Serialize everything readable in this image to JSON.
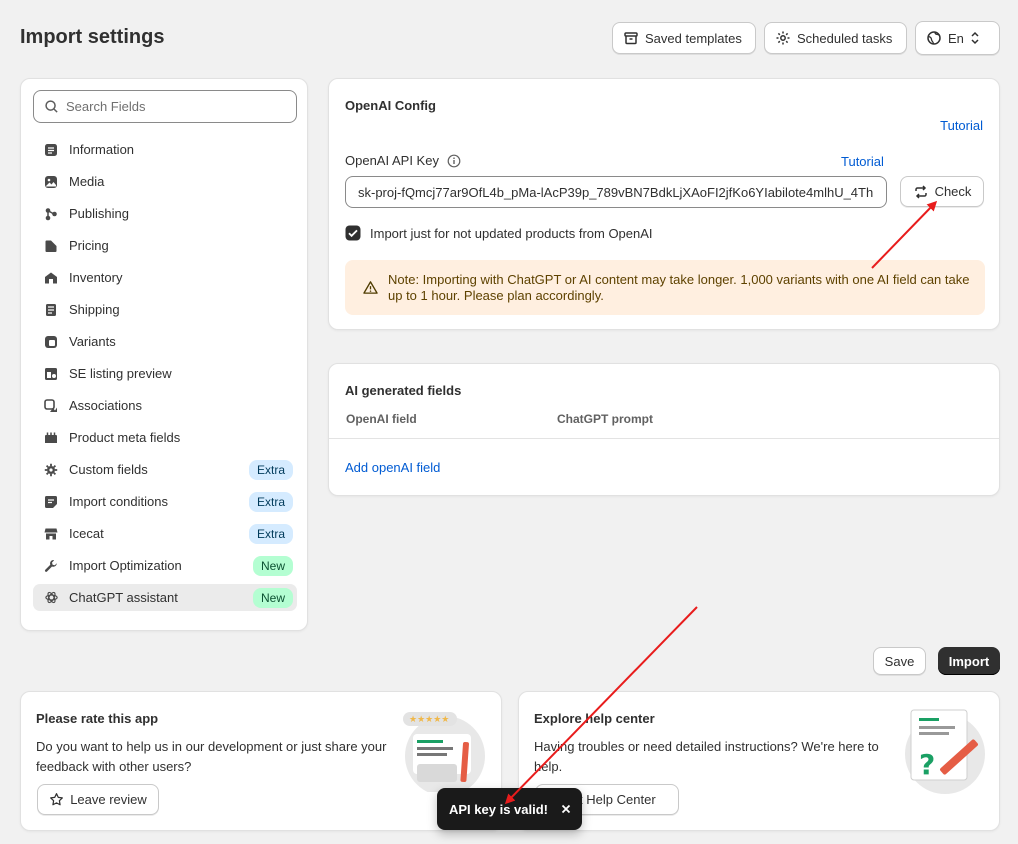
{
  "page": {
    "title": "Import settings"
  },
  "top_actions": {
    "saved_templates": "Saved templates",
    "scheduled_tasks": "Scheduled tasks",
    "language": "En"
  },
  "sidebar": {
    "search_placeholder": "Search Fields",
    "items": [
      {
        "label": "Information",
        "icon": "document-icon"
      },
      {
        "label": "Media",
        "icon": "image-icon"
      },
      {
        "label": "Publishing",
        "icon": "publishing-icon"
      },
      {
        "label": "Pricing",
        "icon": "price-tag-icon"
      },
      {
        "label": "Inventory",
        "icon": "inventory-icon"
      },
      {
        "label": "Shipping",
        "icon": "shipping-icon"
      },
      {
        "label": "Variants",
        "icon": "variants-icon"
      },
      {
        "label": "SE listing preview",
        "icon": "se-preview-icon"
      },
      {
        "label": "Associations",
        "icon": "associations-icon"
      },
      {
        "label": "Product meta fields",
        "icon": "metafields-icon"
      },
      {
        "label": "Custom fields",
        "icon": "gear-icon",
        "badge": "Extra"
      },
      {
        "label": "Import conditions",
        "icon": "conditions-icon",
        "badge": "Extra"
      },
      {
        "label": "Icecat",
        "icon": "store-icon",
        "badge": "Extra"
      },
      {
        "label": "Import Optimization",
        "icon": "wrench-icon",
        "badge": "New"
      },
      {
        "label": "ChatGPT assistant",
        "icon": "openai-icon",
        "badge": "New"
      }
    ]
  },
  "openai_config": {
    "title": "OpenAI Config",
    "tutorial_top": "Tutorial",
    "api_key_label": "OpenAI API Key",
    "api_key_tutorial": "Tutorial",
    "api_key_value": "sk-proj-fQmcj77ar9OfL4b_pMa-lAcP39p_789vBN7BdkLjXAoFI2jfKo6YIabilote4mlhU_4Th",
    "check_button": "Check",
    "checkbox_label": "Import just for not updated products from OpenAI",
    "checkbox_checked": true,
    "note": "Note: Importing with ChatGPT or AI content may take longer. 1,000 variants with one AI field can take up to 1 hour. Please plan accordingly."
  },
  "ai_fields": {
    "title": "AI generated fields",
    "col_field": "OpenAI field",
    "col_prompt": "ChatGPT prompt",
    "add_link": "Add openAI field"
  },
  "actions": {
    "save": "Save",
    "import": "Import"
  },
  "rate_card": {
    "title": "Please rate this app",
    "text": "Do you want to help us in our development or just share your feedback with other users?",
    "button": "Leave review"
  },
  "help_card": {
    "title": "Explore help center",
    "text": "Having troubles or need detailed instructions? We're here to help.",
    "button": "Visit Help Center"
  },
  "toast": {
    "message": "API key is valid!"
  },
  "colors": {
    "link": "#005bd3",
    "annotation_arrow": "#e81c1c",
    "note_bg": "#ffefe0"
  }
}
